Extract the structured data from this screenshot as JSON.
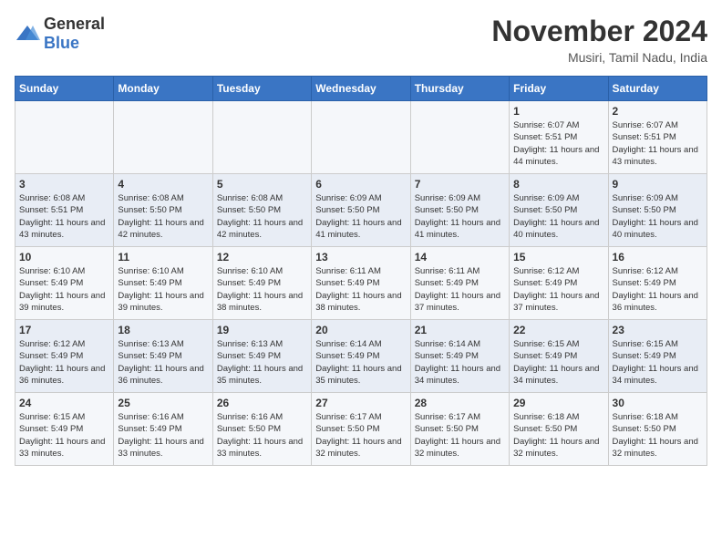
{
  "logo": {
    "general": "General",
    "blue": "Blue"
  },
  "title": "November 2024",
  "subtitle": "Musiri, Tamil Nadu, India",
  "days_of_week": [
    "Sunday",
    "Monday",
    "Tuesday",
    "Wednesday",
    "Thursday",
    "Friday",
    "Saturday"
  ],
  "weeks": [
    [
      {
        "day": "",
        "info": ""
      },
      {
        "day": "",
        "info": ""
      },
      {
        "day": "",
        "info": ""
      },
      {
        "day": "",
        "info": ""
      },
      {
        "day": "",
        "info": ""
      },
      {
        "day": "1",
        "info": "Sunrise: 6:07 AM\nSunset: 5:51 PM\nDaylight: 11 hours and 44 minutes."
      },
      {
        "day": "2",
        "info": "Sunrise: 6:07 AM\nSunset: 5:51 PM\nDaylight: 11 hours and 43 minutes."
      }
    ],
    [
      {
        "day": "3",
        "info": "Sunrise: 6:08 AM\nSunset: 5:51 PM\nDaylight: 11 hours and 43 minutes."
      },
      {
        "day": "4",
        "info": "Sunrise: 6:08 AM\nSunset: 5:50 PM\nDaylight: 11 hours and 42 minutes."
      },
      {
        "day": "5",
        "info": "Sunrise: 6:08 AM\nSunset: 5:50 PM\nDaylight: 11 hours and 42 minutes."
      },
      {
        "day": "6",
        "info": "Sunrise: 6:09 AM\nSunset: 5:50 PM\nDaylight: 11 hours and 41 minutes."
      },
      {
        "day": "7",
        "info": "Sunrise: 6:09 AM\nSunset: 5:50 PM\nDaylight: 11 hours and 41 minutes."
      },
      {
        "day": "8",
        "info": "Sunrise: 6:09 AM\nSunset: 5:50 PM\nDaylight: 11 hours and 40 minutes."
      },
      {
        "day": "9",
        "info": "Sunrise: 6:09 AM\nSunset: 5:50 PM\nDaylight: 11 hours and 40 minutes."
      }
    ],
    [
      {
        "day": "10",
        "info": "Sunrise: 6:10 AM\nSunset: 5:49 PM\nDaylight: 11 hours and 39 minutes."
      },
      {
        "day": "11",
        "info": "Sunrise: 6:10 AM\nSunset: 5:49 PM\nDaylight: 11 hours and 39 minutes."
      },
      {
        "day": "12",
        "info": "Sunrise: 6:10 AM\nSunset: 5:49 PM\nDaylight: 11 hours and 38 minutes."
      },
      {
        "day": "13",
        "info": "Sunrise: 6:11 AM\nSunset: 5:49 PM\nDaylight: 11 hours and 38 minutes."
      },
      {
        "day": "14",
        "info": "Sunrise: 6:11 AM\nSunset: 5:49 PM\nDaylight: 11 hours and 37 minutes."
      },
      {
        "day": "15",
        "info": "Sunrise: 6:12 AM\nSunset: 5:49 PM\nDaylight: 11 hours and 37 minutes."
      },
      {
        "day": "16",
        "info": "Sunrise: 6:12 AM\nSunset: 5:49 PM\nDaylight: 11 hours and 36 minutes."
      }
    ],
    [
      {
        "day": "17",
        "info": "Sunrise: 6:12 AM\nSunset: 5:49 PM\nDaylight: 11 hours and 36 minutes."
      },
      {
        "day": "18",
        "info": "Sunrise: 6:13 AM\nSunset: 5:49 PM\nDaylight: 11 hours and 36 minutes."
      },
      {
        "day": "19",
        "info": "Sunrise: 6:13 AM\nSunset: 5:49 PM\nDaylight: 11 hours and 35 minutes."
      },
      {
        "day": "20",
        "info": "Sunrise: 6:14 AM\nSunset: 5:49 PM\nDaylight: 11 hours and 35 minutes."
      },
      {
        "day": "21",
        "info": "Sunrise: 6:14 AM\nSunset: 5:49 PM\nDaylight: 11 hours and 34 minutes."
      },
      {
        "day": "22",
        "info": "Sunrise: 6:15 AM\nSunset: 5:49 PM\nDaylight: 11 hours and 34 minutes."
      },
      {
        "day": "23",
        "info": "Sunrise: 6:15 AM\nSunset: 5:49 PM\nDaylight: 11 hours and 34 minutes."
      }
    ],
    [
      {
        "day": "24",
        "info": "Sunrise: 6:15 AM\nSunset: 5:49 PM\nDaylight: 11 hours and 33 minutes."
      },
      {
        "day": "25",
        "info": "Sunrise: 6:16 AM\nSunset: 5:49 PM\nDaylight: 11 hours and 33 minutes."
      },
      {
        "day": "26",
        "info": "Sunrise: 6:16 AM\nSunset: 5:50 PM\nDaylight: 11 hours and 33 minutes."
      },
      {
        "day": "27",
        "info": "Sunrise: 6:17 AM\nSunset: 5:50 PM\nDaylight: 11 hours and 32 minutes."
      },
      {
        "day": "28",
        "info": "Sunrise: 6:17 AM\nSunset: 5:50 PM\nDaylight: 11 hours and 32 minutes."
      },
      {
        "day": "29",
        "info": "Sunrise: 6:18 AM\nSunset: 5:50 PM\nDaylight: 11 hours and 32 minutes."
      },
      {
        "day": "30",
        "info": "Sunrise: 6:18 AM\nSunset: 5:50 PM\nDaylight: 11 hours and 32 minutes."
      }
    ]
  ]
}
